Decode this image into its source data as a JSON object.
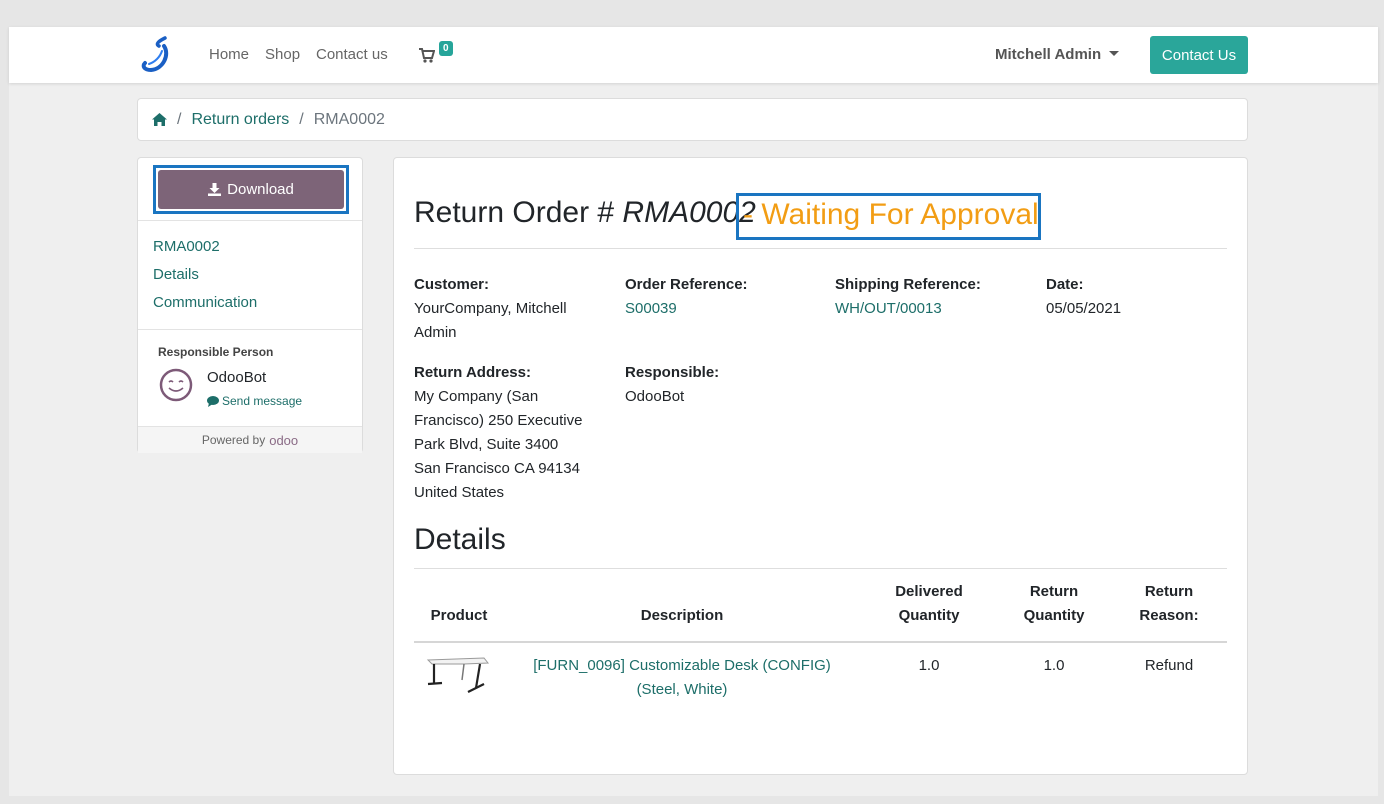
{
  "nav": {
    "links": [
      "Home",
      "Shop",
      "Contact us"
    ],
    "cart_count": "0",
    "user": "Mitchell Admin",
    "contact_button": "Contact Us"
  },
  "breadcrumb": {
    "link": "Return orders",
    "current": "RMA0002"
  },
  "sidebar": {
    "download": "Download",
    "links": [
      "RMA0002",
      "Details",
      "Communication"
    ],
    "responsible_title": "Responsible Person",
    "responsible_name": "OdooBot",
    "send_message": "Send message",
    "powered_by": "Powered by",
    "powered_brand": "odoo"
  },
  "order": {
    "title_prefix": "Return Order # ",
    "reference": "RMA0002",
    "status": "- Waiting For Approval",
    "status_color": "#f29d14",
    "customer_label": "Customer:",
    "customer_lines": [
      "YourCompany, Mitchell",
      "Admin"
    ],
    "order_ref_label": "Order Reference:",
    "order_ref": "S00039",
    "shipping_ref_label": "Shipping Reference:",
    "shipping_ref": "WH/OUT/00013",
    "date_label": "Date:",
    "date": "05/05/2021",
    "return_address_label": "Return Address:",
    "return_address_lines": [
      "My Company (San",
      "Francisco) 250 Executive",
      "Park Blvd, Suite 3400",
      "San Francisco CA 94134",
      "United States"
    ],
    "responsible_label": "Responsible:",
    "responsible": "OdooBot"
  },
  "details": {
    "heading": "Details",
    "headers": {
      "product": "Product",
      "description": "Description",
      "delivered_1": "Delivered",
      "delivered_2": "Quantity",
      "return_1": "Return",
      "return_2": "Quantity",
      "reason_1": "Return",
      "reason_2": "Reason:"
    },
    "rows": [
      {
        "description_1": "[FURN_0096] Customizable Desk (CONFIG)",
        "description_2": "(Steel, White)",
        "delivered_qty": "1.0",
        "return_qty": "1.0",
        "reason": "Refund"
      }
    ]
  },
  "colors": {
    "accent": "#2aa69a",
    "link": "#1d6e69",
    "download_button": "#7d6478",
    "highlight_outline": "#1a75c1"
  }
}
